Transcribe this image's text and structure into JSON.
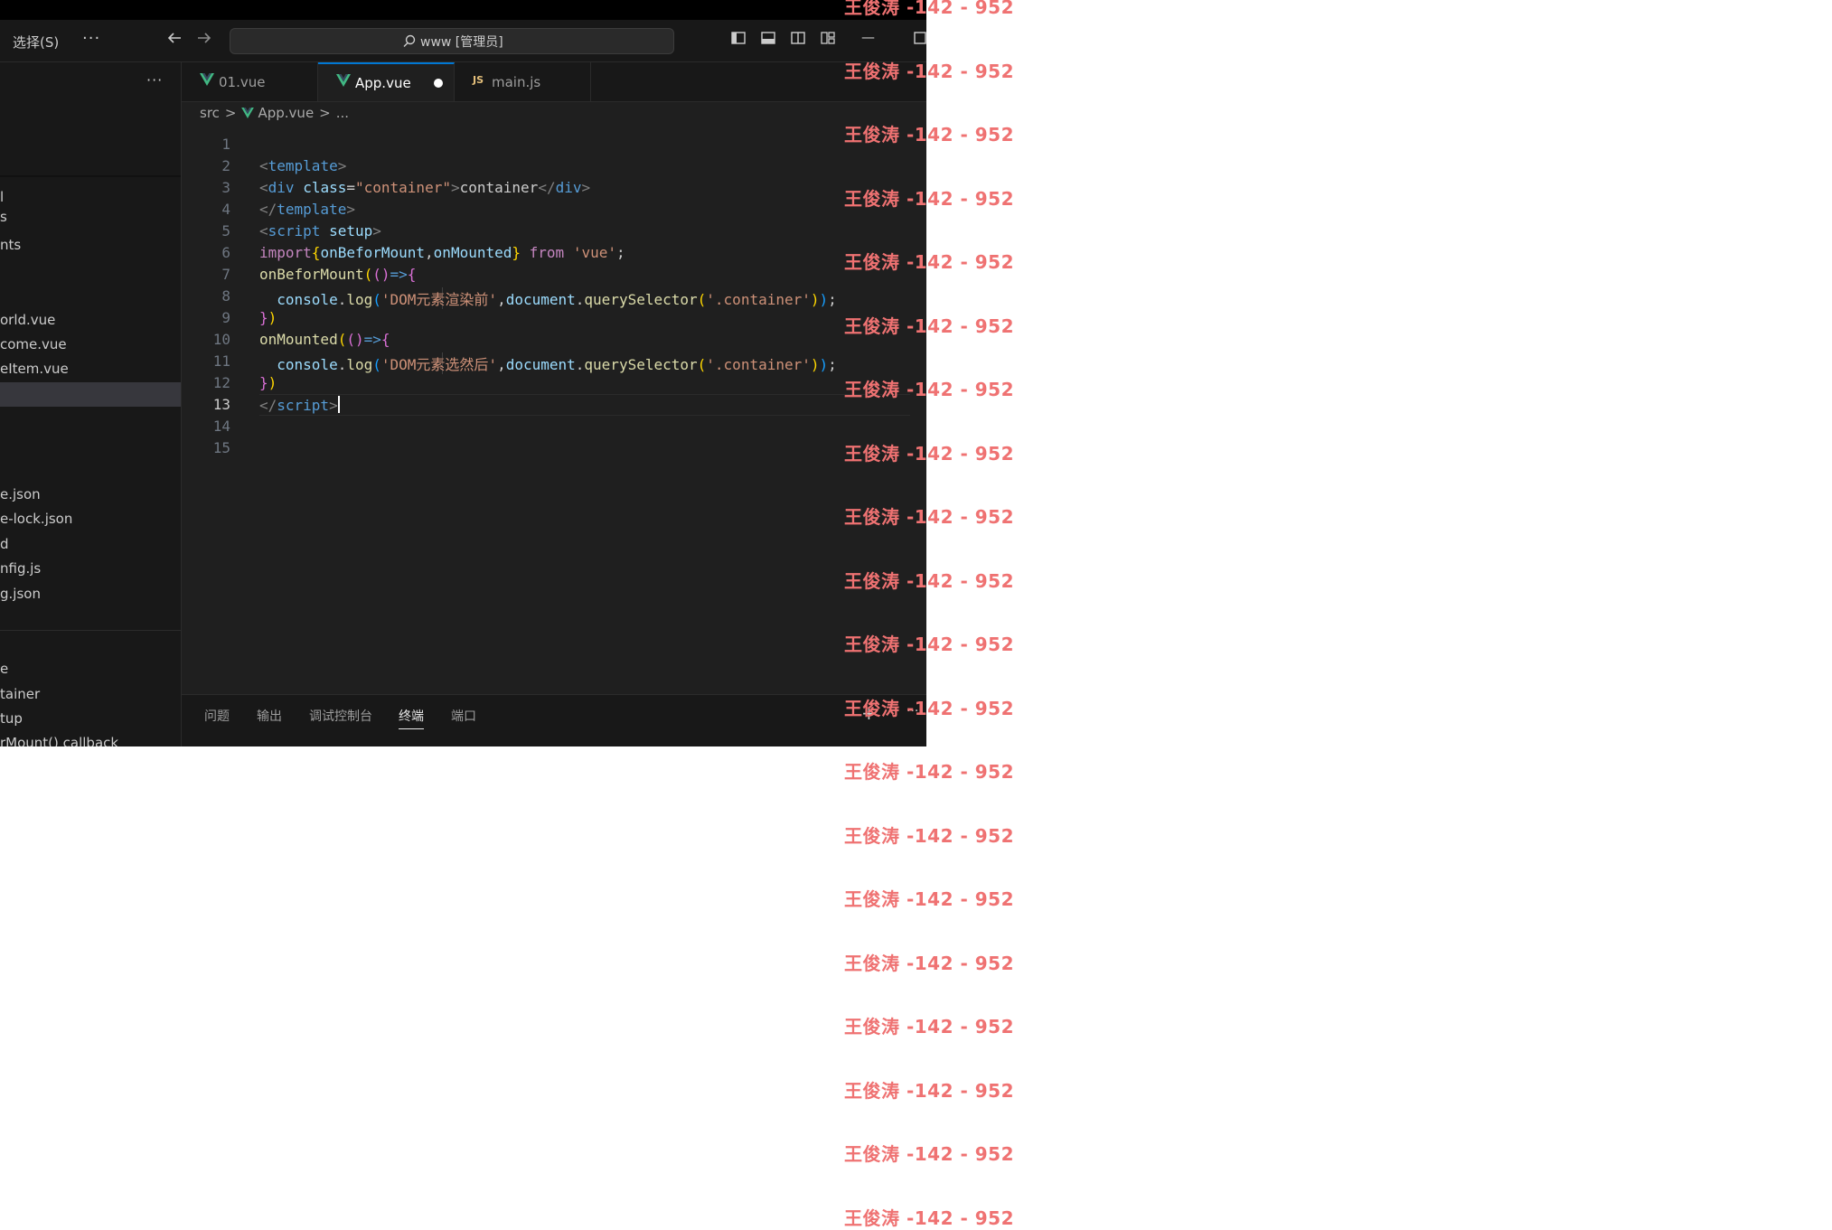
{
  "titlebar": {
    "menu_select": "选择(S)",
    "more_icon": "more-horizontal-icon",
    "back_icon": "arrow-left-icon",
    "forward_icon": "arrow-right-icon",
    "search_label": "www [管理员]",
    "minimize": "—"
  },
  "sidebar": {
    "more": "···",
    "items": [
      {
        "label": "l"
      },
      {
        "label": "s"
      },
      {
        "label": "nts"
      },
      {
        "label": "orld.vue"
      },
      {
        "label": "come.vue"
      },
      {
        "label": "eItem.vue"
      },
      {
        "label": "e.json"
      },
      {
        "label": "e-lock.json"
      },
      {
        "label": "d"
      },
      {
        "label": "nfig.js"
      },
      {
        "label": "g.json"
      },
      {
        "label": "e"
      },
      {
        "label": "tainer"
      },
      {
        "label": "tup"
      },
      {
        "label": "rMount() callback"
      }
    ]
  },
  "tabs": [
    {
      "label": "01.vue",
      "icon": "vue-icon"
    },
    {
      "label": "App.vue",
      "icon": "vue-icon",
      "active": true,
      "modified": true
    },
    {
      "label": "main.js",
      "icon": "js-icon",
      "icon_text": "JS"
    }
  ],
  "breadcrumb": {
    "folder": "src",
    "sep": ">",
    "file": "App.vue",
    "ellipsis": "..."
  },
  "editor": {
    "line_numbers": [
      "1",
      "2",
      "3",
      "4",
      "5",
      "6",
      "7",
      "8",
      "9",
      "10",
      "11",
      "12",
      "13",
      "14",
      "15"
    ],
    "current_line": "13",
    "lines": [
      [],
      [
        {
          "c": "t-tag",
          "t": "<"
        },
        {
          "c": "t-name",
          "t": "template"
        },
        {
          "c": "t-tag",
          "t": ">"
        }
      ],
      [
        {
          "c": "t-tag",
          "t": "<"
        },
        {
          "c": "t-name",
          "t": "div"
        },
        {
          "c": "t-plain",
          "t": " "
        },
        {
          "c": "t-attr",
          "t": "class"
        },
        {
          "c": "t-plain",
          "t": "="
        },
        {
          "c": "t-str",
          "t": "\"container\""
        },
        {
          "c": "t-tag",
          "t": ">"
        },
        {
          "c": "t-plain",
          "t": "container"
        },
        {
          "c": "t-tag",
          "t": "</"
        },
        {
          "c": "t-name",
          "t": "div"
        },
        {
          "c": "t-tag",
          "t": ">"
        }
      ],
      [
        {
          "c": "t-tag",
          "t": "</"
        },
        {
          "c": "t-name",
          "t": "template"
        },
        {
          "c": "t-tag",
          "t": ">"
        }
      ],
      [
        {
          "c": "t-tag",
          "t": "<"
        },
        {
          "c": "t-name",
          "t": "script"
        },
        {
          "c": "t-plain",
          "t": " "
        },
        {
          "c": "t-attr",
          "t": "setup"
        },
        {
          "c": "t-tag",
          "t": ">"
        }
      ],
      [
        {
          "c": "t-kw",
          "t": "import"
        },
        {
          "c": "t-br1",
          "t": "{"
        },
        {
          "c": "t-var",
          "t": "onBeforMount"
        },
        {
          "c": "t-plain",
          "t": ","
        },
        {
          "c": "t-var",
          "t": "onMounted"
        },
        {
          "c": "t-br1",
          "t": "}"
        },
        {
          "c": "t-plain",
          "t": " "
        },
        {
          "c": "t-kw",
          "t": "from"
        },
        {
          "c": "t-plain",
          "t": " "
        },
        {
          "c": "t-str",
          "t": "'vue'"
        },
        {
          "c": "t-plain",
          "t": ";"
        }
      ],
      [
        {
          "c": "t-fn",
          "t": "onBeforMount"
        },
        {
          "c": "t-br1",
          "t": "("
        },
        {
          "c": "t-br2",
          "t": "()"
        },
        {
          "c": "t-name",
          "t": "=>"
        },
        {
          "c": "t-br2",
          "t": "{"
        }
      ],
      [
        {
          "c": "t-plain",
          "t": "  "
        },
        {
          "c": "t-var",
          "t": "console"
        },
        {
          "c": "t-plain",
          "t": "."
        },
        {
          "c": "t-fn",
          "t": "log"
        },
        {
          "c": "t-br3",
          "t": "("
        },
        {
          "c": "t-str",
          "t": "'DOM元素渲染前'"
        },
        {
          "c": "t-plain",
          "t": ","
        },
        {
          "c": "t-var",
          "t": "document"
        },
        {
          "c": "t-plain",
          "t": "."
        },
        {
          "c": "t-fn",
          "t": "querySelector"
        },
        {
          "c": "t-br1",
          "t": "("
        },
        {
          "c": "t-str",
          "t": "'.container'"
        },
        {
          "c": "t-br1",
          "t": ")"
        },
        {
          "c": "t-br3",
          "t": ")"
        },
        {
          "c": "t-plain",
          "t": ";"
        }
      ],
      [
        {
          "c": "t-br2",
          "t": "}"
        },
        {
          "c": "t-br1",
          "t": ")"
        }
      ],
      [
        {
          "c": "t-fn",
          "t": "onMounted"
        },
        {
          "c": "t-br1",
          "t": "("
        },
        {
          "c": "t-br2",
          "t": "()"
        },
        {
          "c": "t-name",
          "t": "=>"
        },
        {
          "c": "t-br2",
          "t": "{"
        }
      ],
      [
        {
          "c": "t-plain",
          "t": "  "
        },
        {
          "c": "t-var",
          "t": "console"
        },
        {
          "c": "t-plain",
          "t": "."
        },
        {
          "c": "t-fn",
          "t": "log"
        },
        {
          "c": "t-br3",
          "t": "("
        },
        {
          "c": "t-str",
          "t": "'DOM元素选然后'"
        },
        {
          "c": "t-plain",
          "t": ","
        },
        {
          "c": "t-var",
          "t": "document"
        },
        {
          "c": "t-plain",
          "t": "."
        },
        {
          "c": "t-fn",
          "t": "querySelector"
        },
        {
          "c": "t-br1",
          "t": "("
        },
        {
          "c": "t-str",
          "t": "'.container'"
        },
        {
          "c": "t-br1",
          "t": ")"
        },
        {
          "c": "t-br3",
          "t": ")"
        },
        {
          "c": "t-plain",
          "t": ";"
        }
      ],
      [
        {
          "c": "t-br2",
          "t": "}"
        },
        {
          "c": "t-br1",
          "t": ")"
        }
      ],
      [
        {
          "c": "t-tag",
          "t": "</"
        },
        {
          "c": "t-name",
          "t": "script"
        },
        {
          "c": "t-tag",
          "t": ">"
        }
      ],
      [],
      []
    ]
  },
  "panel": {
    "tabs": [
      "问题",
      "输出",
      "调试控制台",
      "终端",
      "端口"
    ],
    "active": "终端",
    "add": "+",
    "more": "···"
  },
  "watermark": {
    "text": "王俊涛 -142 - 952",
    "color": "#ef7272",
    "rows": 20
  }
}
